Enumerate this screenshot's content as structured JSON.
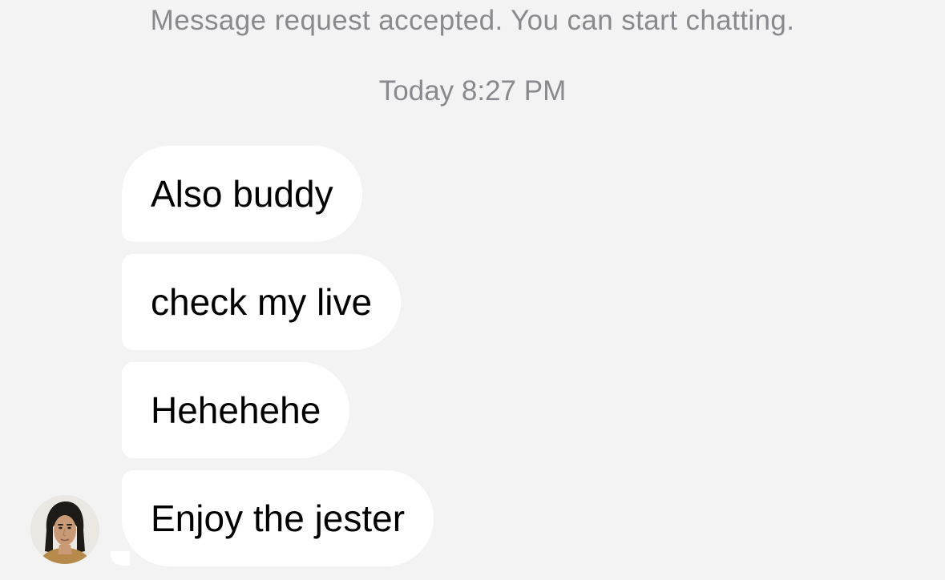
{
  "conversation": {
    "system_notice": "Message request accepted. You can start chatting.",
    "timestamp": "Today 8:27 PM",
    "messages": [
      {
        "text": "Also buddy"
      },
      {
        "text": "check my live"
      },
      {
        "text": "Hehehehe"
      },
      {
        "text": "Enjoy the jester"
      }
    ]
  },
  "colors": {
    "background": "#f3f3f3",
    "bubble": "#ffffff",
    "meta_text": "#8a8a8e",
    "message_text": "#000000"
  },
  "icons": {
    "sender_avatar": "avatar"
  }
}
